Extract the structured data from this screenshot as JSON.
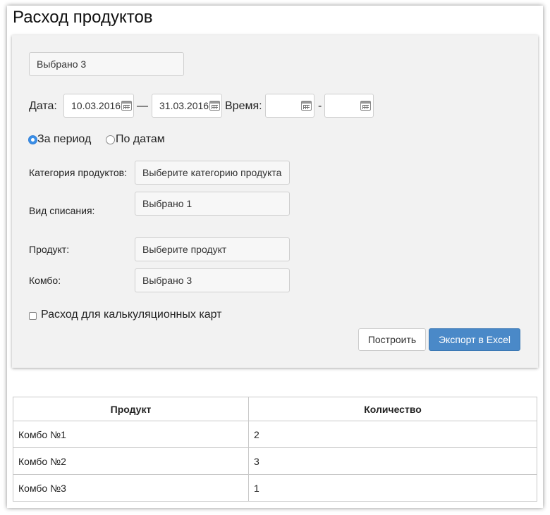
{
  "page": {
    "title": "Расход продуктов"
  },
  "filters": {
    "selected_top": "Выбрано 3",
    "date_label": "Дата:",
    "date_from": "10.03.2016",
    "date_sep": "—",
    "date_to": "31.03.2016",
    "time_label": "Время:",
    "time_from": "",
    "time_sep": "-",
    "time_to": "",
    "radio_period_label": "За период",
    "radio_dates_label": "По датам",
    "category_label": "Категория продуктов:",
    "category_value": "Выберите категорию продукта",
    "writeoff_label": "Вид списания:",
    "writeoff_value": "Выбрано 1",
    "product_label": "Продукт:",
    "product_value": "Выберите продукт",
    "combo_label": "Комбо:",
    "combo_value": "Выбрано 3",
    "checkbox_label": "Расход для калькуляционных карт",
    "build_button": "Построить",
    "export_button": "Экспорт в Excel"
  },
  "table": {
    "headers": [
      "Продукт",
      "Количество"
    ],
    "rows": [
      [
        "Комбо №1",
        "2"
      ],
      [
        "Комбо №2",
        "3"
      ],
      [
        "Комбо №3",
        "1"
      ]
    ]
  },
  "colors": {
    "primary_button": "#4a89c8",
    "panel_bg": "#f2f2f2",
    "radio_selected": "#3b8fe6"
  }
}
